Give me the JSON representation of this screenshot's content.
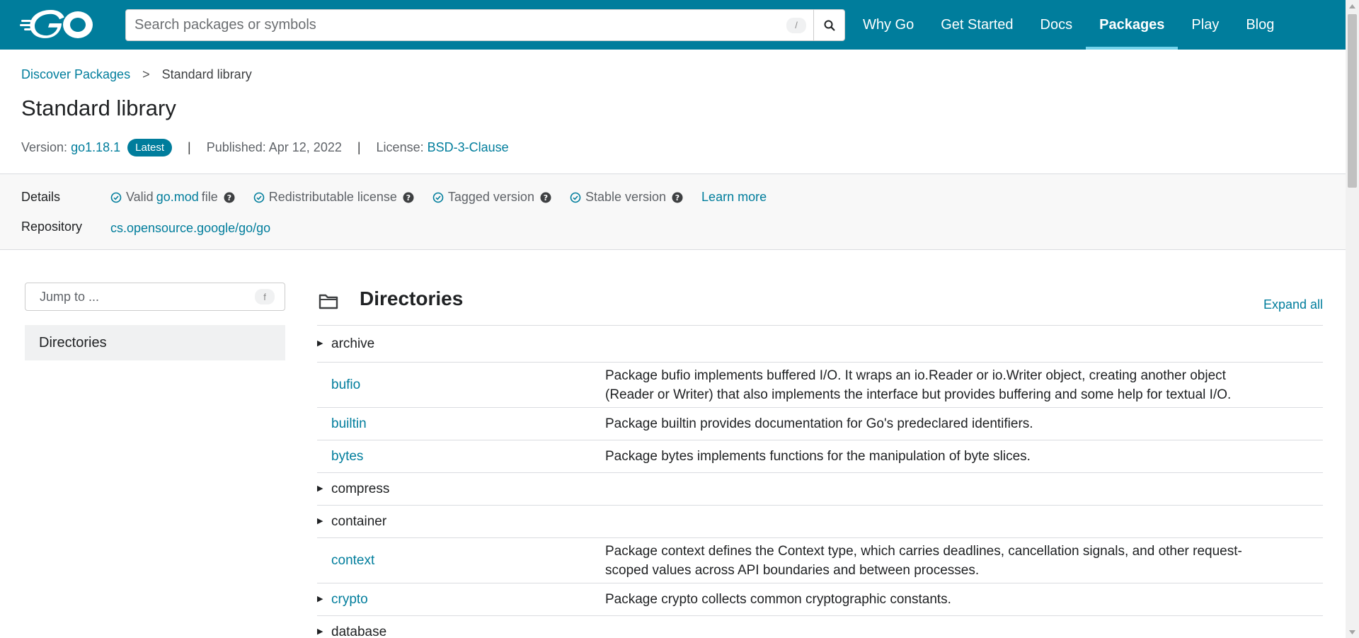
{
  "header": {
    "search_placeholder": "Search packages or symbols",
    "search_shortcut": "/",
    "nav": [
      {
        "label": "Why Go",
        "active": false
      },
      {
        "label": "Get Started",
        "active": false
      },
      {
        "label": "Docs",
        "active": false
      },
      {
        "label": "Packages",
        "active": true
      },
      {
        "label": "Play",
        "active": false
      },
      {
        "label": "Blog",
        "active": false
      }
    ]
  },
  "breadcrumb": {
    "parent": "Discover Packages",
    "separator": ">",
    "current": "Standard library"
  },
  "page": {
    "title": "Standard library",
    "version_label": "Version:",
    "version": "go1.18.1",
    "latest_badge": "Latest",
    "divider": "|",
    "published": "Published: Apr 12, 2022",
    "license_label": "License:",
    "license": "BSD-3-Clause"
  },
  "details": {
    "label": "Details",
    "valid_prefix": "Valid",
    "valid_link": "go.mod",
    "valid_suffix": "file",
    "redistributable": "Redistributable license",
    "tagged": "Tagged version",
    "stable": "Stable version",
    "learn_more": "Learn more",
    "repository_label": "Repository",
    "repository": "cs.opensource.google/go/go"
  },
  "sidebar": {
    "jump_placeholder": "Jump to ...",
    "jump_shortcut": "f",
    "directories": "Directories"
  },
  "directories": {
    "title": "Directories",
    "expand_all": "Expand all",
    "rows": [
      {
        "name": "archive",
        "expandable": true,
        "link": false,
        "desc": ""
      },
      {
        "name": "bufio",
        "expandable": false,
        "link": true,
        "desc": "Package bufio implements buffered I/O. It wraps an io.Reader or io.Writer object, creating another object (Reader or Writer) that also implements the interface but provides buffering and some help for textual I/O."
      },
      {
        "name": "builtin",
        "expandable": false,
        "link": true,
        "desc": "Package builtin provides documentation for Go's predeclared identifiers."
      },
      {
        "name": "bytes",
        "expandable": false,
        "link": true,
        "desc": "Package bytes implements functions for the manipulation of byte slices."
      },
      {
        "name": "compress",
        "expandable": true,
        "link": false,
        "desc": ""
      },
      {
        "name": "container",
        "expandable": true,
        "link": false,
        "desc": ""
      },
      {
        "name": "context",
        "expandable": false,
        "link": true,
        "desc": "Package context defines the Context type, which carries deadlines, cancellation signals, and other request-scoped values across API boundaries and between processes."
      },
      {
        "name": "crypto",
        "expandable": true,
        "link": true,
        "desc": "Package crypto collects common cryptographic constants."
      },
      {
        "name": "database",
        "expandable": true,
        "link": false,
        "desc": ""
      }
    ]
  },
  "colors": {
    "brand": "#007d9c",
    "nav_active_underline": "#74d3eb",
    "text": "#202224",
    "details_bg": "#f8f8f8"
  }
}
